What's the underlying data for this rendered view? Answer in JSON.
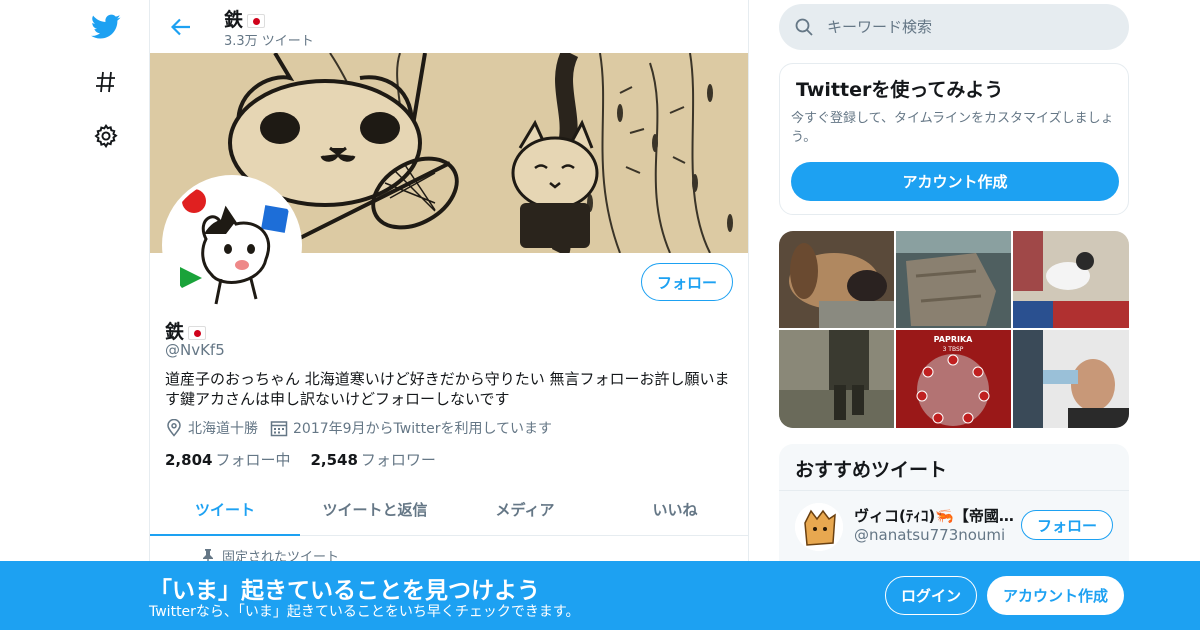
{
  "nav": {
    "icons": [
      "twitter-bird-icon",
      "hashtag-icon",
      "gear-icon"
    ]
  },
  "header": {
    "title": "鉄",
    "tweet_count": "3.3万 ツイート"
  },
  "profile": {
    "name": "鉄",
    "handle": "@NvKf5",
    "bio": "道産子のおっちゃん 北海道寒いけど好きだから守りたい 無言フォローお許し願います鍵アカさんは申し訳ないけどフォローしないです",
    "location": "北海道十勝",
    "joined": "2017年9月からTwitterを利用しています",
    "following_count": "2,804",
    "following_label": "フォロー中",
    "followers_count": "2,548",
    "followers_label": "フォロワー",
    "follow_button": "フォロー"
  },
  "tabs": [
    {
      "label": "ツイート",
      "active": true
    },
    {
      "label": "ツイートと返信",
      "active": false
    },
    {
      "label": "メディア",
      "active": false
    },
    {
      "label": "いいね",
      "active": false
    }
  ],
  "pinned_label": "固定されたツイート",
  "search": {
    "placeholder": "キーワード検索"
  },
  "signup_card": {
    "title": "Twitterを使ってみよう",
    "description": "今すぐ登録して、タイムラインをカスタマイズしましょう。",
    "button": "アカウント作成"
  },
  "media_thumbnails": [
    {
      "label": "dog-photo",
      "color": "#8a6a4a"
    },
    {
      "label": "stone-photo",
      "color": "#6f7d78"
    },
    {
      "label": "dog-on-mat-photo",
      "color": "#b06060"
    },
    {
      "label": "person-walking-photo",
      "color": "#7d7a6a"
    },
    {
      "label": "paprika-plate-photo",
      "color": "#b02020"
    },
    {
      "label": "barber-photo",
      "color": "#4a5560"
    }
  ],
  "media_overlay_text": "PAPRIKA",
  "media_overlay_sub": "3 TBSP",
  "recommended": {
    "title": "おすすめツイート",
    "user_name": "ヴィコ(ﾃｨｺ)🦐【帝國海軍】",
    "user_handle": "@nanatsu773noumi",
    "follow_button": "フォロー"
  },
  "bottom_bar": {
    "title": "「いま」起きていることを見つけよう",
    "subtitle": "Twitterなら、「いま」起きていることをいち早くチェックできます。",
    "login": "ログイン",
    "signup": "アカウント作成"
  },
  "colors": {
    "accent": "#1da1f2",
    "muted_text": "#657786",
    "border": "#e6ecf0"
  }
}
